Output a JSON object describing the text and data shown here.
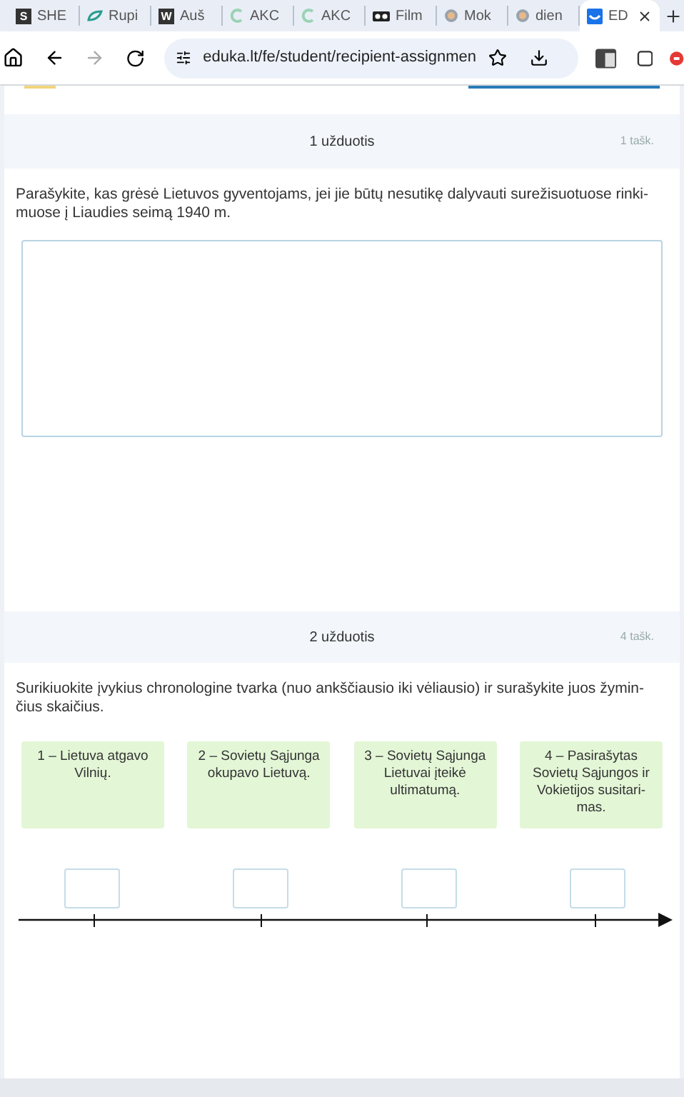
{
  "browser": {
    "tabs": [
      {
        "label": "SHE",
        "kind": "letter",
        "icon_text": "S",
        "selected": false
      },
      {
        "label": "Rupi",
        "kind": "leaf",
        "selected": false
      },
      {
        "label": "Auš",
        "kind": "letter",
        "icon_text": "W",
        "selected": false
      },
      {
        "label": "AKC",
        "kind": "ring",
        "selected": false
      },
      {
        "label": "AKC",
        "kind": "ring",
        "selected": false
      },
      {
        "label": "Film",
        "kind": "glasses",
        "selected": false
      },
      {
        "label": "Mok",
        "kind": "globe",
        "selected": false
      },
      {
        "label": "dien",
        "kind": "globe",
        "selected": false
      },
      {
        "label": "ED",
        "kind": "mark",
        "selected": true
      }
    ],
    "url": "eduka.lt/fe/student/recipient-assignmen"
  },
  "tasks": [
    {
      "title": "1 užduotis",
      "points": "1 tašk.",
      "question": "Parašykite, kas grėsė Lietuvos gyventojams, jei jie būtų nesutikę dalyvauti surežisuotuose rinki-muose į Liaudies seimą 1940 m.",
      "kind": "text-answer"
    },
    {
      "title": "2 užduotis",
      "points": "4 tašk.",
      "question": "Surikiuokite įvykius chronologine tvarka (nuo ankščiausio iki vėliausio) ir surašykite juos žymin-čius skaičius.",
      "kind": "timeline",
      "events": [
        "1 – Lietuva atgavo Vilnių.",
        "2 – Sovietų Sąjunga okupavo Lietuvą.",
        "3 – Sovietų Sąjunga Lietuvai įteikė ultimatumą.",
        "4 – Pasirašytas Sovietų Sąjungos ir Vokietijos susitari-mas."
      ]
    }
  ]
}
